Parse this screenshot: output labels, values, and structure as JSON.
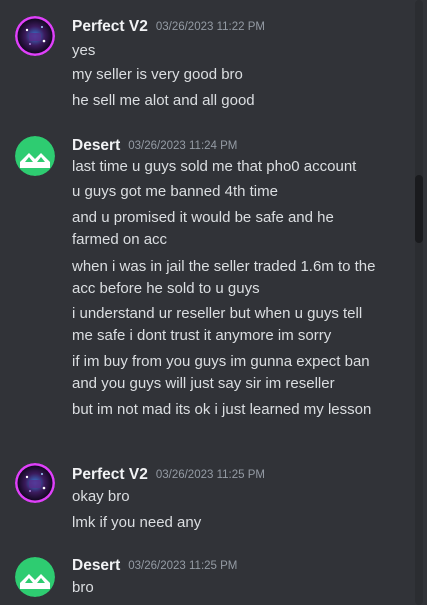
{
  "messages": [
    {
      "username": "Perfect V2",
      "timestamp": "03/26/2023 11:22 PM",
      "avatar_icon": "galaxy-avatar-icon",
      "lines": [
        "yes",
        "my seller is very good bro",
        "he sell me alot and all good"
      ]
    },
    {
      "username": "Desert",
      "timestamp": "03/26/2023 11:24 PM",
      "avatar_icon": "green-mountain-avatar-icon",
      "lines": [
        "last time u guys sold me that pho0 account",
        "u guys got me banned 4th time",
        "and u promised it would be safe and he farmed on acc",
        "when i was in jail the seller traded 1.6m to the acc before he sold to u guys",
        "i understand ur reseller but when u guys tell me safe i dont trust it anymore im sorry",
        "if im buy from you guys im gunna expect ban and you guys will just say sir im reseller",
        "but im not mad its ok i just learned my lesson"
      ]
    },
    {
      "username": "Perfect V2",
      "timestamp": "03/26/2023 11:25 PM",
      "avatar_icon": "galaxy-avatar-icon",
      "lines": [
        "okay bro",
        "lmk if you need any"
      ]
    },
    {
      "username": "Desert",
      "timestamp": "03/26/2023 11:25 PM",
      "avatar_icon": "green-mountain-avatar-icon",
      "lines": [
        "bro"
      ]
    }
  ],
  "colors": {
    "background": "#313338",
    "username": "#f2f3f5",
    "timestamp": "#949ba4",
    "message_text": "#dbdee1",
    "desert_avatar": "#2ecc71",
    "perfect_avatar_ring": "#d63cff"
  }
}
